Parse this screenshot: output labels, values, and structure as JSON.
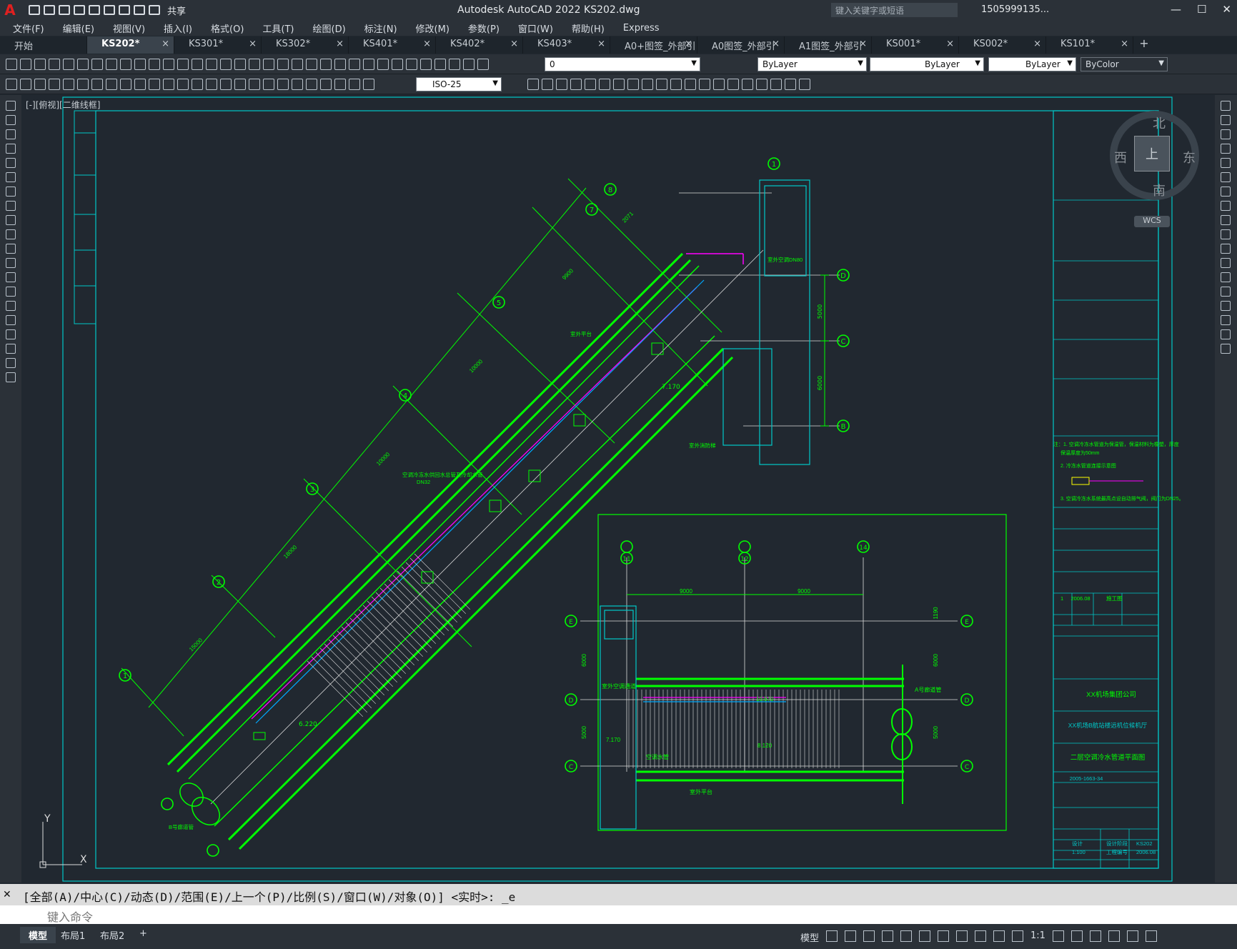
{
  "app": {
    "logo": "A",
    "title": "Autodesk AutoCAD 2022    KS202.dwg",
    "share_label": "共享",
    "search_placeholder": "键入关键字或短语",
    "user": "1505999135...",
    "win_min": "—",
    "win_max": "☐",
    "win_close": "✕"
  },
  "menu": [
    "文件(F)",
    "编辑(E)",
    "视图(V)",
    "插入(I)",
    "格式(O)",
    "工具(T)",
    "绘图(D)",
    "标注(N)",
    "修改(M)",
    "参数(P)",
    "窗口(W)",
    "帮助(H)",
    "Express"
  ],
  "tabs": [
    {
      "label": "开始",
      "active": false,
      "closable": false
    },
    {
      "label": "KS202*",
      "active": true,
      "closable": true
    },
    {
      "label": "KS301*",
      "active": false,
      "closable": true
    },
    {
      "label": "KS302*",
      "active": false,
      "closable": true
    },
    {
      "label": "KS401*",
      "active": false,
      "closable": true
    },
    {
      "label": "KS402*",
      "active": false,
      "closable": true
    },
    {
      "label": "KS403*",
      "active": false,
      "closable": true
    },
    {
      "label": "A0+图签_外部引用*",
      "active": false,
      "closable": true
    },
    {
      "label": "A0图签_外部引用",
      "active": false,
      "closable": true
    },
    {
      "label": "A1图签_外部引用*",
      "active": false,
      "closable": true
    },
    {
      "label": "KS001*",
      "active": false,
      "closable": true
    },
    {
      "label": "KS002*",
      "active": false,
      "closable": true
    },
    {
      "label": "KS101*",
      "active": false,
      "closable": true
    }
  ],
  "toolbar": {
    "layer_value": "0",
    "color_value": "ByLayer",
    "linetype_value": "ByLayer",
    "lineweight_value": "ByLayer",
    "plotstyle_value": "ByColor",
    "dimstyle_value": "ISO-25"
  },
  "viewport": {
    "label": "[-][俯视][二维线框]",
    "compass": {
      "north": "北",
      "south": "南",
      "east": "东",
      "west": "西",
      "top": "上"
    },
    "wcs": "WCS"
  },
  "drawing": {
    "grid_top": [
      {
        "num": "8",
        "label": "8"
      },
      {
        "num": "7",
        "label": "7"
      },
      {
        "num": "5",
        "label": "5"
      },
      {
        "num": "4",
        "label": "4"
      },
      {
        "num": "3",
        "label": "3"
      },
      {
        "num": "2",
        "label": "2"
      },
      {
        "num": "1",
        "label": "1"
      }
    ],
    "grid_right": [
      {
        "num": "1",
        "label": "1"
      },
      {
        "num": "D",
        "label": "D"
      },
      {
        "num": "C",
        "label": "C"
      },
      {
        "num": "B",
        "label": "B"
      }
    ],
    "dims_main": [
      "2071",
      "9900",
      "10000",
      "10000",
      "18000",
      "15000"
    ],
    "dims_right": [
      "5000",
      "6000"
    ],
    "levels": [
      "7.170",
      "6.220"
    ],
    "notes_main": [
      "空调冷冻水供回水总管及冷却水管",
      "DN32",
      "B号廊道管",
      "室外平台",
      "室外消防梯",
      "室外空调DN80"
    ],
    "inset": {
      "grid_top": [
        {
          "num": "11"
        },
        {
          "num": "12"
        },
        {
          "num": "14"
        }
      ],
      "grid_side": [
        "E",
        "D",
        "C"
      ],
      "dims_top": [
        "9000",
        "9000"
      ],
      "dims_side_left": [
        "6000",
        "5000"
      ],
      "dims_side_right": [
        "1190",
        "6000",
        "5000"
      ],
      "levels": [
        "10.970",
        "7.170",
        "8.120"
      ],
      "notes": [
        "A号廊道管",
        "室外平台",
        "空调水管",
        "室外空调通道"
      ]
    }
  },
  "titleblock": {
    "company": "XX机场集团公司",
    "project": "XX机场B航站楼远机位候机厅",
    "drawing_title": "二层空调冷水管道平面图",
    "drawing_no": "2005-1663-34",
    "date": "2006.08",
    "revision": "1",
    "phase": "施工图",
    "scale": "1:100",
    "sheet": "KS202",
    "design": "设计",
    "note_1": "注：1. 空调冷冻水管道为保温管，保温材料为橡塑，厚度",
    "note_1b": "保温厚度为50mm",
    "note_2": "2. 冷冻水管道连接示意图",
    "note_3": "3. 空调冷冻水系统最高点设自动排气阀，阀门为DN25。",
    "col_a": "设计阶段",
    "col_b": "工程编号"
  },
  "command": {
    "history": "[全部(A)/中心(C)/动态(D)/范围(E)/上一个(P)/比例(S)/窗口(W)/对象(O)] <实时>: _e",
    "placeholder": "键入命令",
    "close_icon": "✕"
  },
  "status": {
    "layouts": [
      {
        "label": "模型",
        "active": true
      },
      {
        "label": "布局1",
        "active": false
      },
      {
        "label": "布局2",
        "active": false
      },
      {
        "label": "+",
        "active": false
      }
    ],
    "model_label": "模型",
    "scale": "1:1"
  },
  "colors": {
    "background": "#212830",
    "chrome": "#2b3138",
    "green": "#00ff00",
    "cyan": "#00c8c8",
    "magenta": "#ff00ff",
    "white": "#e6e6e6"
  }
}
